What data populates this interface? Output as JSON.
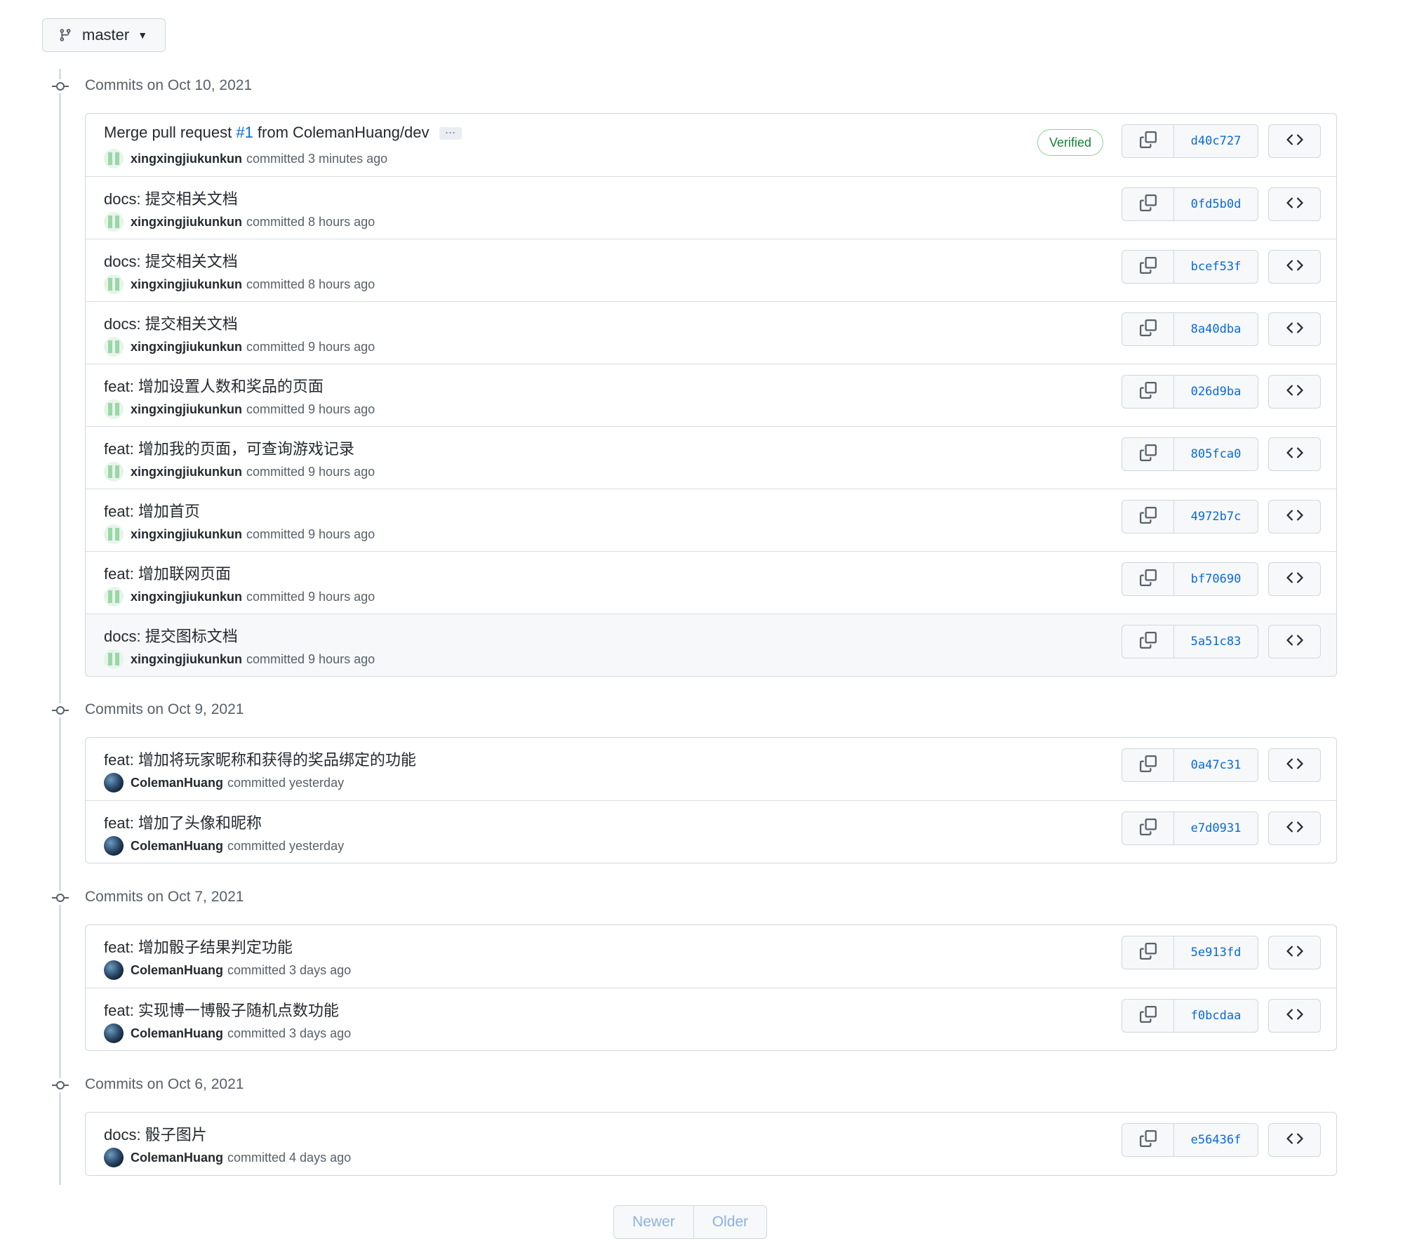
{
  "branch": {
    "name": "master"
  },
  "groups": [
    {
      "title": "Commits on Oct 10, 2021",
      "commits": [
        {
          "message_prefix": "Merge pull request ",
          "pr_link": "#1",
          "message_suffix": " from ColemanHuang/dev",
          "has_ellipsis": true,
          "ellipsis": "…",
          "author": "xingxingjiukunkun",
          "avatar": "identicon",
          "time_text": "committed 3 minutes ago",
          "verified": "Verified",
          "sha": "d40c727"
        },
        {
          "message": "docs: 提交相关文档",
          "author": "xingxingjiukunkun",
          "avatar": "identicon",
          "time_text": "committed 8 hours ago",
          "sha": "0fd5b0d"
        },
        {
          "message": "docs: 提交相关文档",
          "author": "xingxingjiukunkun",
          "avatar": "identicon",
          "time_text": "committed 8 hours ago",
          "sha": "bcef53f"
        },
        {
          "message": "docs: 提交相关文档",
          "author": "xingxingjiukunkun",
          "avatar": "identicon",
          "time_text": "committed 9 hours ago",
          "sha": "8a40dba"
        },
        {
          "message": "feat: 增加设置人数和奖品的页面",
          "author": "xingxingjiukunkun",
          "avatar": "identicon",
          "time_text": "committed 9 hours ago",
          "sha": "026d9ba"
        },
        {
          "message": "feat: 增加我的页面，可查询游戏记录",
          "author": "xingxingjiukunkun",
          "avatar": "identicon",
          "time_text": "committed 9 hours ago",
          "sha": "805fca0"
        },
        {
          "message": "feat: 增加首页",
          "author": "xingxingjiukunkun",
          "avatar": "identicon",
          "time_text": "committed 9 hours ago",
          "sha": "4972b7c"
        },
        {
          "message": "feat: 增加联网页面",
          "author": "xingxingjiukunkun",
          "avatar": "identicon",
          "time_text": "committed 9 hours ago",
          "sha": "bf70690"
        },
        {
          "message": "docs: 提交图标文档",
          "author": "xingxingjiukunkun",
          "avatar": "identicon",
          "time_text": "committed 9 hours ago",
          "sha": "5a51c83",
          "highlight": true
        }
      ]
    },
    {
      "title": "Commits on Oct 9, 2021",
      "commits": [
        {
          "message": "feat: 增加将玩家昵称和获得的奖品绑定的功能",
          "author": "ColemanHuang",
          "avatar": "photo",
          "time_text": "committed yesterday",
          "sha": "0a47c31"
        },
        {
          "message": "feat: 增加了头像和昵称",
          "author": "ColemanHuang",
          "avatar": "photo",
          "time_text": "committed yesterday",
          "sha": "e7d0931"
        }
      ]
    },
    {
      "title": "Commits on Oct 7, 2021",
      "commits": [
        {
          "message": "feat: 增加骰子结果判定功能",
          "author": "ColemanHuang",
          "avatar": "photo",
          "time_text": "committed 3 days ago",
          "sha": "5e913fd"
        },
        {
          "message": "feat: 实现博一博骰子随机点数功能",
          "author": "ColemanHuang",
          "avatar": "photo",
          "time_text": "committed 3 days ago",
          "sha": "f0bcdaa"
        }
      ]
    },
    {
      "title": "Commits on Oct 6, 2021",
      "commits": [
        {
          "message": "docs: 骰子图片",
          "author": "ColemanHuang",
          "avatar": "photo",
          "time_text": "committed 4 days ago",
          "sha": "e56436f"
        }
      ]
    }
  ],
  "pagination": {
    "newer": "Newer",
    "older": "Older"
  },
  "icons": {
    "branch": "git-branch-icon",
    "commit": "git-commit-icon",
    "copy": "copy-icon",
    "browse": "code-icon"
  },
  "colors": {
    "link": "#0969da",
    "verified": "#1a7f37",
    "border": "#d0d7de"
  }
}
